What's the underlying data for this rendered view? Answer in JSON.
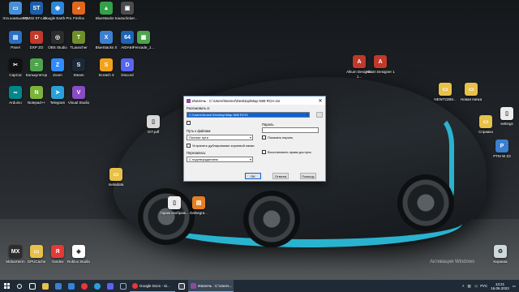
{
  "desktop": {
    "icons": [
      {
        "label": "Эта компьютер",
        "color": "#4a8fd6",
        "glyph": "▭",
        "icon": "computer-icon"
      },
      {
        "label": "STM32 ST-Link...",
        "color": "#1f5fa8",
        "glyph": "ST",
        "icon": "stm-icon"
      },
      {
        "label": "Google Earth Pro",
        "color": "#2f86d9",
        "glyph": "◉",
        "icon": "globe-icon"
      },
      {
        "label": "Firefox",
        "color": "#e2661b",
        "glyph": "◕",
        "icon": "firefox-icon"
      },
      {
        "label": "BlueStacks 5",
        "color": "#35a04a",
        "glyph": "▲",
        "icon": "bluestacks-icon"
      },
      {
        "label": "autoclicker...",
        "color": "#4c4c4c",
        "glyph": "▣",
        "icon": "autoclicker-icon"
      },
      {
        "label": "Panel",
        "color": "#2b6fc2",
        "glyph": "▤",
        "icon": "panel-icon"
      },
      {
        "label": "DXP ZO",
        "color": "#c23a2b",
        "glyph": "D",
        "icon": "dxp-icon"
      },
      {
        "label": "OBS Studio",
        "color": "#2d2d2d",
        "glyph": "◎",
        "icon": "obs-icon"
      },
      {
        "label": "TLauncher",
        "color": "#6f8f2a",
        "glyph": "T",
        "icon": "tlauncher-icon"
      },
      {
        "label": "BlueStacks X",
        "color": "#3d7fd0",
        "glyph": "X",
        "icon": "bluestacks-x-icon"
      },
      {
        "label": "AIDA64",
        "color": "#1d64b8",
        "glyph": "64",
        "icon": "aida-icon"
      },
      {
        "label": "Fencade_1...",
        "color": "#4fa34f",
        "glyph": "▦",
        "icon": "fencade-icon"
      },
      {
        "label": "CapCut",
        "color": "#111111",
        "glyph": "✂",
        "icon": "capcut-icon"
      },
      {
        "label": "Калькулятор",
        "color": "#4fa34f",
        "glyph": "=",
        "icon": "calculator-icon"
      },
      {
        "label": "Zoom",
        "color": "#2d8cff",
        "glyph": "Z",
        "icon": "zoom-icon"
      },
      {
        "label": "Steam",
        "color": "#1b2838",
        "glyph": "S",
        "icon": "steam-icon"
      },
      {
        "label": "Scratch 3",
        "color": "#f4a21b",
        "glyph": "S",
        "icon": "scratch-icon"
      },
      {
        "label": "Discord",
        "color": "#5865f2",
        "glyph": "D",
        "icon": "discord-icon"
      },
      {
        "label": "Arduino",
        "color": "#00878a",
        "glyph": "∞",
        "icon": "arduino-icon"
      },
      {
        "label": "Notepad++",
        "color": "#7bb33a",
        "glyph": "N",
        "icon": "notepad-icon"
      },
      {
        "label": "Telegram",
        "color": "#2aa0da",
        "glyph": "➤",
        "icon": "telegram-icon"
      },
      {
        "label": "Visual Studio",
        "color": "#8a4cc4",
        "glyph": "V",
        "icon": "vs-icon"
      },
      {
        "label": "GIT.pdf",
        "color": "#d8d8d8",
        "glyph": "▯",
        "icon": "pdf-icon"
      },
      {
        "label": "MobaXterm",
        "color": "#2c2c2c",
        "glyph": "MX",
        "icon": "moba-icon"
      },
      {
        "label": "GPUCache",
        "color": "#e7c14a",
        "glyph": "▭",
        "icon": "folder-icon"
      },
      {
        "label": "Yandex",
        "color": "#e53935",
        "glyph": "Я",
        "icon": "yandex-icon"
      },
      {
        "label": "Roblox Studio",
        "color": "#ffffff",
        "glyph": "◆",
        "icon": "roblox-icon"
      },
      {
        "label": "Alkum Designer 1...",
        "color": "#c0392b",
        "glyph": "A",
        "icon": "altium-icon"
      },
      {
        "label": "Altium Designer 1",
        "color": "#c0392b",
        "glyph": "A",
        "icon": "altium2-icon"
      },
      {
        "label": "NEW722B8...",
        "color": "#e7c14a",
        "glyph": "▭",
        "icon": "folder-icon-2"
      },
      {
        "label": "Новая папка",
        "color": "#e7c14a",
        "glyph": "▭",
        "icon": "folder-icon-3"
      },
      {
        "label": "settings",
        "color": "#ececec",
        "glyph": "▯",
        "icon": "file-icon"
      },
      {
        "label": "Справка",
        "color": "#e7c14a",
        "glyph": "▭",
        "icon": "folder-icon-4"
      },
      {
        "label": "PTM W Z3",
        "color": "#3b7fd0",
        "glyph": "P",
        "icon": "ptm-icon"
      },
      {
        "label": "Корзина",
        "color": "#cfd8dc",
        "glyph": "♻",
        "icon": "recycle-bin-icon"
      },
      {
        "label": "metadata",
        "color": "#e7c14a",
        "glyph": "▭",
        "icon": "folder-icon-5"
      },
      {
        "label": "Гараж изображ...",
        "color": "#ececec",
        "glyph": "▯",
        "icon": "file-icon-2"
      },
      {
        "label": "Dalsegra...",
        "color": "#e67e22",
        "glyph": "▤",
        "icon": "archive-icon"
      }
    ]
  },
  "dialog": {
    "title": "Извлечь : C:\\Users\\Nomer\\Desktop\\Map N68 RCH.rar",
    "tab": "Распаковать в:",
    "path_value": "C:\\Users\\Nomer\\Desktop\\Map N68 RCH\\",
    "path_mode_label": "Путь к файлам:",
    "path_mode_value": "Полные пути",
    "overwrite_label": "Перезапись:",
    "overwrite_value": "С подтверждением",
    "password_label": "Пароль",
    "show_password": "Показать пароль",
    "eliminate_dup": "Устранить дублирование корневой папки",
    "restore_security": "Восстановить права доступа",
    "ok": "OK",
    "cancel": "Отмена",
    "help": "Помощь"
  },
  "taskbar": {
    "apps": [
      {
        "label": "Google Docs - Si...",
        "color": "#e53935"
      },
      {
        "label": "Извлечь : C:\\Users...",
        "color": "#8a4c9f"
      }
    ],
    "lang": "РУС",
    "time": "13:21",
    "date": "16.06.2023"
  },
  "watermark": "Активация Windows"
}
